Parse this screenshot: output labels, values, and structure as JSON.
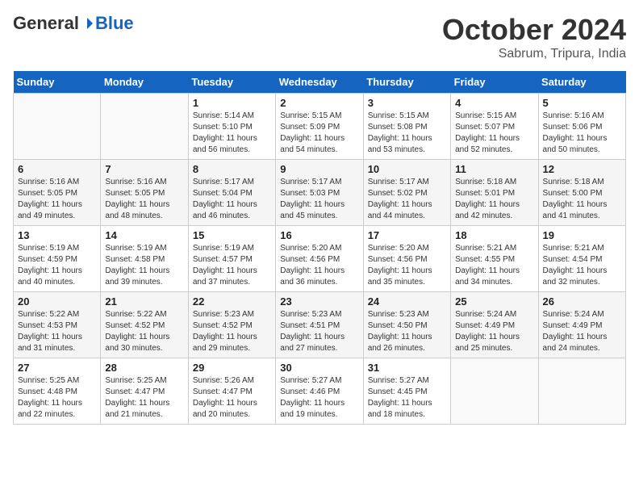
{
  "header": {
    "logo": {
      "general": "General",
      "blue": "Blue"
    },
    "title": "October 2024",
    "location": "Sabrum, Tripura, India"
  },
  "days_of_week": [
    "Sunday",
    "Monday",
    "Tuesday",
    "Wednesday",
    "Thursday",
    "Friday",
    "Saturday"
  ],
  "weeks": [
    [
      {
        "day": "",
        "sunrise": "",
        "sunset": "",
        "daylight": ""
      },
      {
        "day": "",
        "sunrise": "",
        "sunset": "",
        "daylight": ""
      },
      {
        "day": "1",
        "sunrise": "Sunrise: 5:14 AM",
        "sunset": "Sunset: 5:10 PM",
        "daylight": "Daylight: 11 hours and 56 minutes."
      },
      {
        "day": "2",
        "sunrise": "Sunrise: 5:15 AM",
        "sunset": "Sunset: 5:09 PM",
        "daylight": "Daylight: 11 hours and 54 minutes."
      },
      {
        "day": "3",
        "sunrise": "Sunrise: 5:15 AM",
        "sunset": "Sunset: 5:08 PM",
        "daylight": "Daylight: 11 hours and 53 minutes."
      },
      {
        "day": "4",
        "sunrise": "Sunrise: 5:15 AM",
        "sunset": "Sunset: 5:07 PM",
        "daylight": "Daylight: 11 hours and 52 minutes."
      },
      {
        "day": "5",
        "sunrise": "Sunrise: 5:16 AM",
        "sunset": "Sunset: 5:06 PM",
        "daylight": "Daylight: 11 hours and 50 minutes."
      }
    ],
    [
      {
        "day": "6",
        "sunrise": "Sunrise: 5:16 AM",
        "sunset": "Sunset: 5:05 PM",
        "daylight": "Daylight: 11 hours and 49 minutes."
      },
      {
        "day": "7",
        "sunrise": "Sunrise: 5:16 AM",
        "sunset": "Sunset: 5:05 PM",
        "daylight": "Daylight: 11 hours and 48 minutes."
      },
      {
        "day": "8",
        "sunrise": "Sunrise: 5:17 AM",
        "sunset": "Sunset: 5:04 PM",
        "daylight": "Daylight: 11 hours and 46 minutes."
      },
      {
        "day": "9",
        "sunrise": "Sunrise: 5:17 AM",
        "sunset": "Sunset: 5:03 PM",
        "daylight": "Daylight: 11 hours and 45 minutes."
      },
      {
        "day": "10",
        "sunrise": "Sunrise: 5:17 AM",
        "sunset": "Sunset: 5:02 PM",
        "daylight": "Daylight: 11 hours and 44 minutes."
      },
      {
        "day": "11",
        "sunrise": "Sunrise: 5:18 AM",
        "sunset": "Sunset: 5:01 PM",
        "daylight": "Daylight: 11 hours and 42 minutes."
      },
      {
        "day": "12",
        "sunrise": "Sunrise: 5:18 AM",
        "sunset": "Sunset: 5:00 PM",
        "daylight": "Daylight: 11 hours and 41 minutes."
      }
    ],
    [
      {
        "day": "13",
        "sunrise": "Sunrise: 5:19 AM",
        "sunset": "Sunset: 4:59 PM",
        "daylight": "Daylight: 11 hours and 40 minutes."
      },
      {
        "day": "14",
        "sunrise": "Sunrise: 5:19 AM",
        "sunset": "Sunset: 4:58 PM",
        "daylight": "Daylight: 11 hours and 39 minutes."
      },
      {
        "day": "15",
        "sunrise": "Sunrise: 5:19 AM",
        "sunset": "Sunset: 4:57 PM",
        "daylight": "Daylight: 11 hours and 37 minutes."
      },
      {
        "day": "16",
        "sunrise": "Sunrise: 5:20 AM",
        "sunset": "Sunset: 4:56 PM",
        "daylight": "Daylight: 11 hours and 36 minutes."
      },
      {
        "day": "17",
        "sunrise": "Sunrise: 5:20 AM",
        "sunset": "Sunset: 4:56 PM",
        "daylight": "Daylight: 11 hours and 35 minutes."
      },
      {
        "day": "18",
        "sunrise": "Sunrise: 5:21 AM",
        "sunset": "Sunset: 4:55 PM",
        "daylight": "Daylight: 11 hours and 34 minutes."
      },
      {
        "day": "19",
        "sunrise": "Sunrise: 5:21 AM",
        "sunset": "Sunset: 4:54 PM",
        "daylight": "Daylight: 11 hours and 32 minutes."
      }
    ],
    [
      {
        "day": "20",
        "sunrise": "Sunrise: 5:22 AM",
        "sunset": "Sunset: 4:53 PM",
        "daylight": "Daylight: 11 hours and 31 minutes."
      },
      {
        "day": "21",
        "sunrise": "Sunrise: 5:22 AM",
        "sunset": "Sunset: 4:52 PM",
        "daylight": "Daylight: 11 hours and 30 minutes."
      },
      {
        "day": "22",
        "sunrise": "Sunrise: 5:23 AM",
        "sunset": "Sunset: 4:52 PM",
        "daylight": "Daylight: 11 hours and 29 minutes."
      },
      {
        "day": "23",
        "sunrise": "Sunrise: 5:23 AM",
        "sunset": "Sunset: 4:51 PM",
        "daylight": "Daylight: 11 hours and 27 minutes."
      },
      {
        "day": "24",
        "sunrise": "Sunrise: 5:23 AM",
        "sunset": "Sunset: 4:50 PM",
        "daylight": "Daylight: 11 hours and 26 minutes."
      },
      {
        "day": "25",
        "sunrise": "Sunrise: 5:24 AM",
        "sunset": "Sunset: 4:49 PM",
        "daylight": "Daylight: 11 hours and 25 minutes."
      },
      {
        "day": "26",
        "sunrise": "Sunrise: 5:24 AM",
        "sunset": "Sunset: 4:49 PM",
        "daylight": "Daylight: 11 hours and 24 minutes."
      }
    ],
    [
      {
        "day": "27",
        "sunrise": "Sunrise: 5:25 AM",
        "sunset": "Sunset: 4:48 PM",
        "daylight": "Daylight: 11 hours and 22 minutes."
      },
      {
        "day": "28",
        "sunrise": "Sunrise: 5:25 AM",
        "sunset": "Sunset: 4:47 PM",
        "daylight": "Daylight: 11 hours and 21 minutes."
      },
      {
        "day": "29",
        "sunrise": "Sunrise: 5:26 AM",
        "sunset": "Sunset: 4:47 PM",
        "daylight": "Daylight: 11 hours and 20 minutes."
      },
      {
        "day": "30",
        "sunrise": "Sunrise: 5:27 AM",
        "sunset": "Sunset: 4:46 PM",
        "daylight": "Daylight: 11 hours and 19 minutes."
      },
      {
        "day": "31",
        "sunrise": "Sunrise: 5:27 AM",
        "sunset": "Sunset: 4:45 PM",
        "daylight": "Daylight: 11 hours and 18 minutes."
      },
      {
        "day": "",
        "sunrise": "",
        "sunset": "",
        "daylight": ""
      },
      {
        "day": "",
        "sunrise": "",
        "sunset": "",
        "daylight": ""
      }
    ]
  ]
}
